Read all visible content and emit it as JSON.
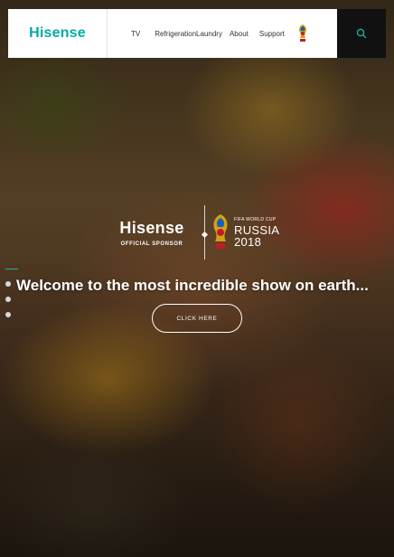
{
  "header": {
    "logo_text": "Hisense",
    "nav": {
      "tv": "TV",
      "refrigeration": "Refrigeration",
      "laundry": "Laundry",
      "about": "About",
      "support": "Support"
    },
    "world_cup_icon": "world-cup-emblem-icon",
    "search_icon": "search-icon"
  },
  "hero": {
    "sponsor_brand": "Hisense",
    "sponsor_subtitle": "OFFICIAL SPONSOR",
    "event_small": "FIFA WORLD CUP",
    "event_name": "RUSSIA",
    "event_year": "2018",
    "headline": "Welcome to the most incredible show on earth...",
    "cta_label": "CLICK HERE"
  },
  "colors": {
    "brand_teal": "#00aaa6",
    "header_bg": "#ffffff",
    "search_bg": "#111111"
  }
}
